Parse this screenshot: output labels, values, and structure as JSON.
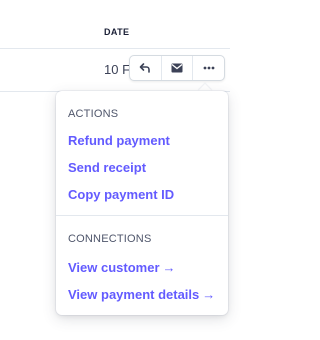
{
  "table": {
    "date_header": "DATE",
    "date_cell": "10 Feb"
  },
  "action_bar": {
    "buttons": [
      {
        "icon": "undo-arrow-icon"
      },
      {
        "icon": "envelope-icon"
      },
      {
        "icon": "ellipsis-icon"
      }
    ]
  },
  "menu": {
    "actions_title": "ACTIONS",
    "refund_payment": "Refund payment",
    "send_receipt": "Send receipt",
    "copy_payment_id": "Copy payment ID",
    "connections_title": "CONNECTIONS",
    "view_customer": "View customer",
    "view_payment_details": "View payment details",
    "link_arrow": "→"
  },
  "colors": {
    "accent": "#635bff",
    "text": "#3c4257",
    "heading": "#1a1f36",
    "muted": "#4f566b",
    "border": "#e3e8ee"
  }
}
